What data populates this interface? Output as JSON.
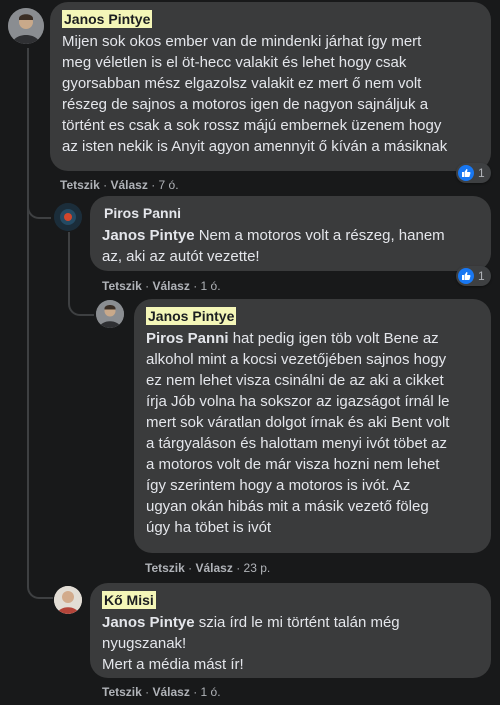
{
  "comments": [
    {
      "author": "Janos Pintye",
      "mention": "",
      "text": "Mijen sok okos ember van de mindenki járhat így mert\nmeg véletlen is el öt-hecc valakit és lehet hogy csak\ngyorsabban mész elgazolsz valakit ez mert ő nem volt\nrészeg de sajnos a motoros igen de nagyon sajnáljuk a\ntörtént es csak a sok rossz májú embernek üzenem hogy\naz isten nekik is Anyit agyon amennyit ő kíván a másiknak",
      "like": "Tetszik",
      "reply": "Válasz",
      "time": "7 ó.",
      "reactions": "1"
    },
    {
      "author": "Piros Panni",
      "mention": "Janos Pintye",
      "text": " Nem a motoros volt a részeg, hanem\naz, aki az autót vezette!",
      "like": "Tetszik",
      "reply": "Válasz",
      "time": "1 ó.",
      "reactions": "1"
    },
    {
      "author": "Janos Pintye",
      "mention": "Piros Panni",
      "text": " hat pedig igen töb volt Bene az\nalkohol mint a kocsi vezetőjében sajnos hogy\nez nem lehet visza csinálni de az aki a cikket\nírja Jób volna ha sokszor az igazságot írnál le\nmert sok váratlan dolgot írnak és aki Bent volt\na tárgyaláson és halottam menyi ivót töbet az\na motoros volt de már visza hozni nem lehet\nígy szerintem hogy a motoros is ivót. Az\nugyan okán hibás mit a másik vezető föleg\núgy ha töbet is ivót",
      "like": "Tetszik",
      "reply": "Válasz",
      "time": "23 p."
    },
    {
      "author": "Kő Misi",
      "mention": "Janos Pintye",
      "text": " szia írd le mi történt talán még\nnyugszanak!\nMert a média mást ír!",
      "like": "Tetszik",
      "reply": "Válasz",
      "time": "1 ó."
    }
  ],
  "colors": {
    "background": "#18191a",
    "bubble": "#3a3b3c",
    "highlight": "#f4f6b8",
    "like_blue": "#1877f2"
  },
  "icons": {
    "like": "thumbs-up-icon"
  }
}
